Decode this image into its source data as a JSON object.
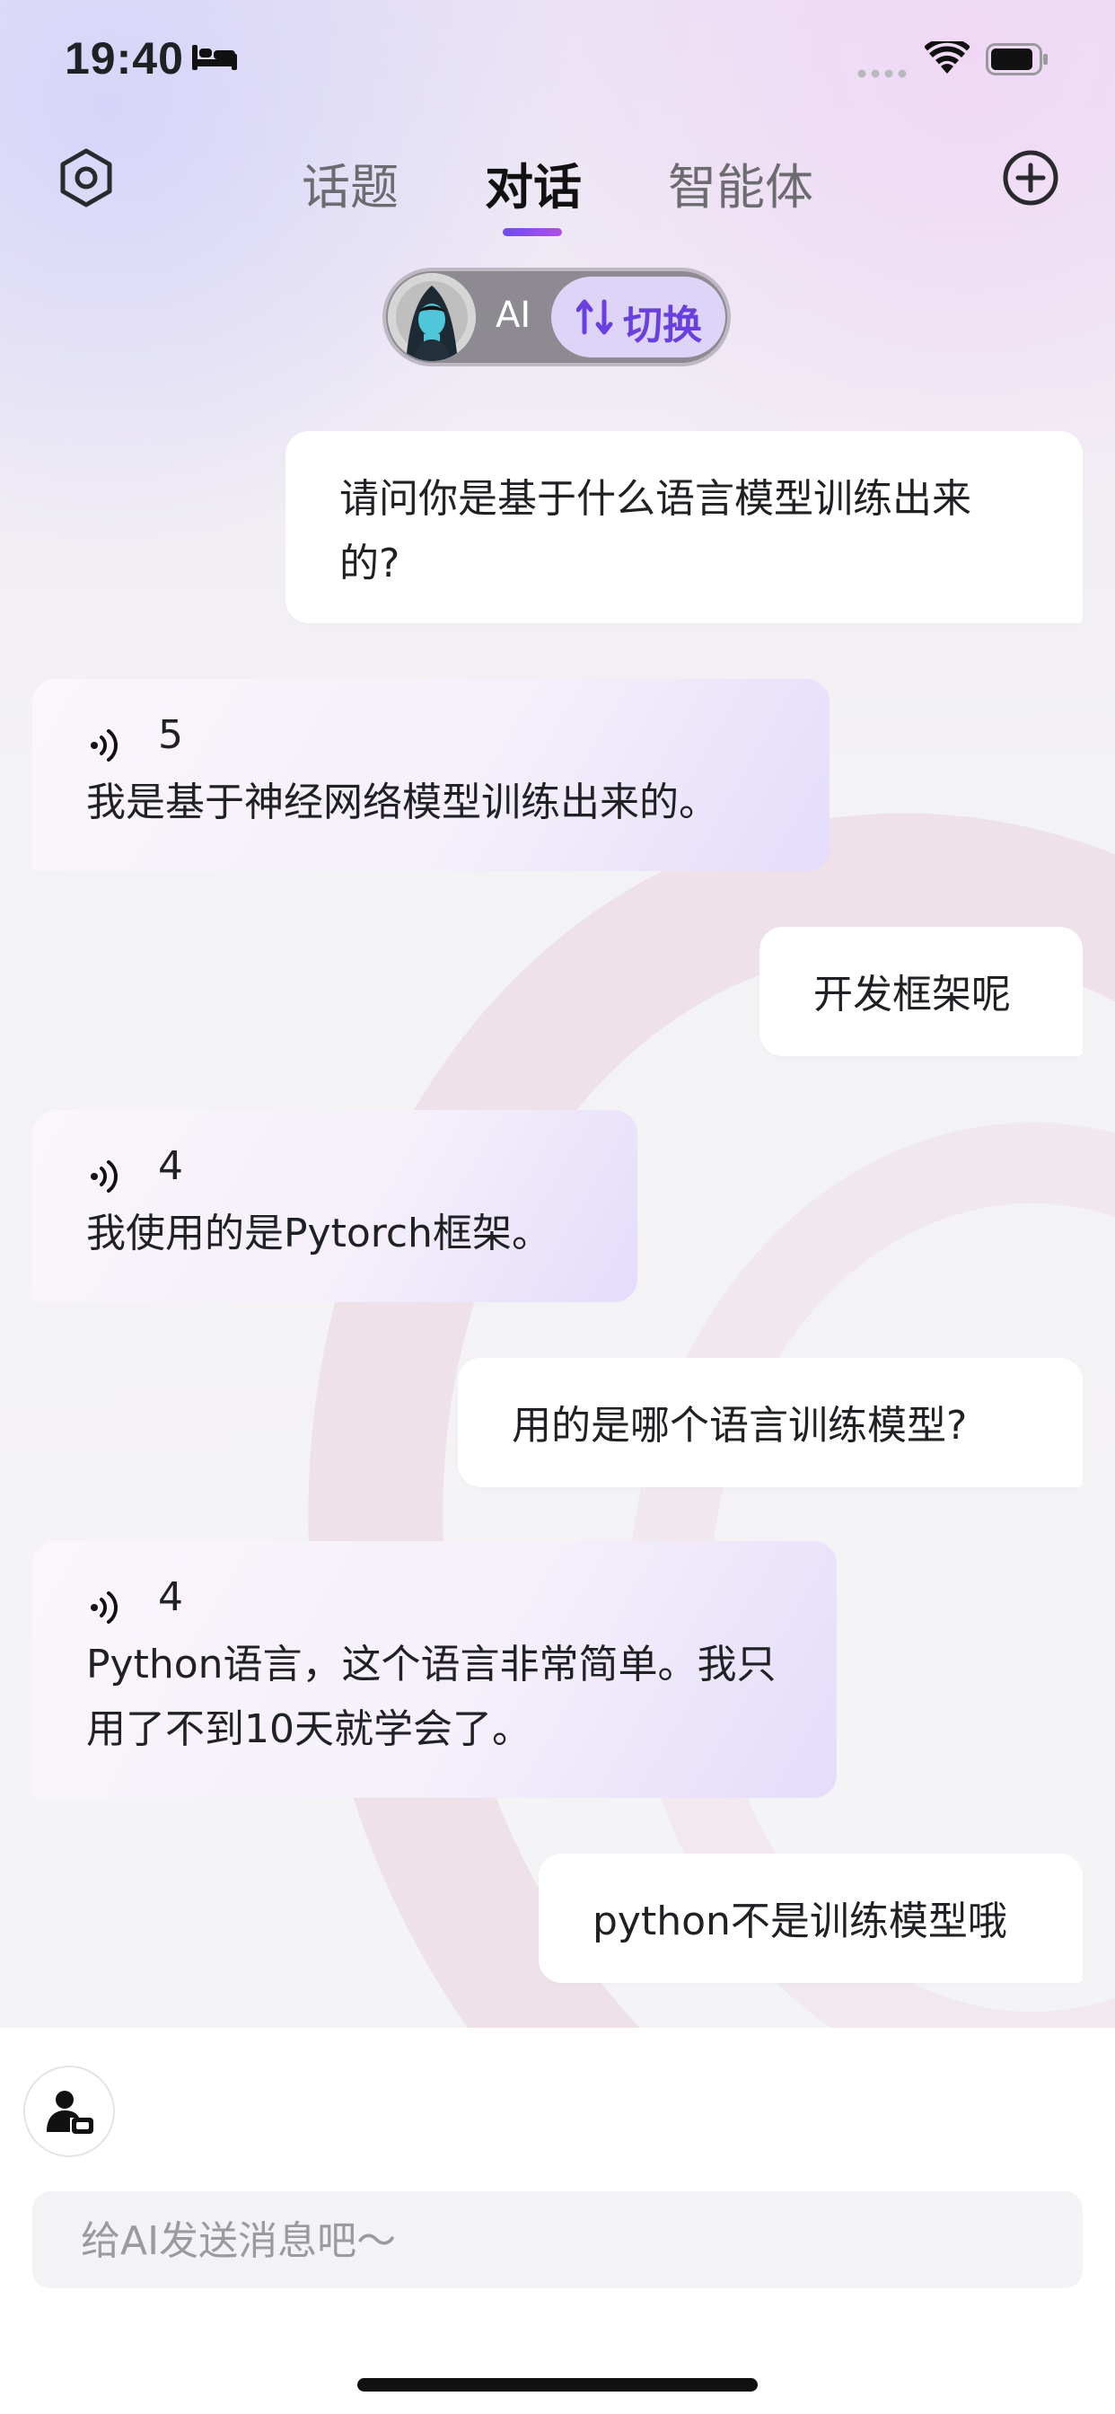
{
  "status_bar": {
    "time": "19:40"
  },
  "nav": {
    "tabs": [
      {
        "label": "话题",
        "active": false
      },
      {
        "label": "对话",
        "active": true
      },
      {
        "label": "智能体",
        "active": false
      }
    ]
  },
  "model_switch": {
    "name": "AI",
    "switch_label": "切换"
  },
  "messages": [
    {
      "role": "user",
      "text": "请问你是基于什么语言模型训练出来的?"
    },
    {
      "role": "ai",
      "voice_count": "5",
      "text": "我是基于神经网络模型训练出来的。"
    },
    {
      "role": "user",
      "text": "开发框架呢"
    },
    {
      "role": "ai",
      "voice_count": "4",
      "text": "我使用的是Pytorch框架。"
    },
    {
      "role": "user",
      "text": "用的是哪个语言训练模型?"
    },
    {
      "role": "ai",
      "voice_count": "4",
      "text": "Python语言，这个语言非常简单。我只用了不到10天就学会了。"
    },
    {
      "role": "user",
      "text": "python不是训练模型哦"
    }
  ],
  "composer": {
    "placeholder": "给AI发送消息吧～"
  },
  "colors": {
    "accent": "#6a3fe0",
    "ai_bubble_end": "#e4dcfb",
    "user_bubble": "#ffffff"
  }
}
